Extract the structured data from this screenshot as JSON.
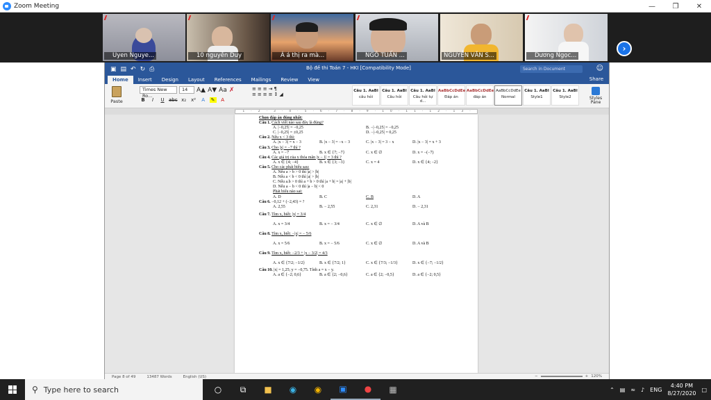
{
  "zoom": {
    "title": "Zoom Meeting",
    "participants": [
      {
        "name": "Uyen Nguye..."
      },
      {
        "name": "10 nguyễn Duy"
      },
      {
        "name": "Á á thị ra mà..."
      },
      {
        "name": "NGÔ TUẤN ..."
      },
      {
        "name": "NGUYỄN VĂN S..."
      },
      {
        "name": "Dương Ngọc..."
      }
    ]
  },
  "word": {
    "doc_title": "Bộ đề thi Toán 7 - HKI [Compatibility Mode]",
    "search_placeholder": "Search in Document",
    "share": "Share",
    "tabs": [
      "Home",
      "Insert",
      "Design",
      "Layout",
      "References",
      "Mailings",
      "Review",
      "View"
    ],
    "paste": "Paste",
    "font_name": "Times New Ro...",
    "font_size": "14",
    "styles": [
      {
        "sample": "Câu 1. AaBl",
        "name": "câu hỏi"
      },
      {
        "sample": "Câu 1. AaBl",
        "name": "Câu hỏi"
      },
      {
        "sample": "Câu 1. AaBl",
        "name": "Câu hỏi tự d..."
      },
      {
        "sample": "AaBbCcDdEe",
        "name": "Đáp án"
      },
      {
        "sample": "AaBbCcDdEe",
        "name": "đáp án"
      },
      {
        "sample": "AaBbCcDdEe",
        "name": "Normal"
      },
      {
        "sample": "Câu 1. AaBl",
        "name": "Style1"
      },
      {
        "sample": "Câu 1. AaBl",
        "name": "Style2"
      }
    ],
    "styles_pane": "Styles Pane",
    "status": {
      "page": "Page 8 of 49",
      "words": "13487 Words",
      "lang": "English (US)",
      "zoom": "120%"
    }
  },
  "document": {
    "heading": "Chọn đáp án đúng nhất:",
    "q1": {
      "label": "Câu 1.",
      "text": "Cách viết nào sau đây là đúng?",
      "a": "A. |−0,25| = −0,25",
      "b": "B. −|−0,25| = −0,25",
      "c": "C. |−0,25| = ±0,25",
      "d": "D. −|−0,25| = 0,25"
    },
    "q2": {
      "label": "Câu 2.",
      "text": "Nếu x < 3 thì:",
      "a": "A. |x − 3| = x − 3",
      "b": "B. |x − 3| = −x − 3",
      "c": "C. |x − 3| = 3 − x",
      "d": "D. |x − 3| = x + 3"
    },
    "q3": {
      "label": "Câu 3.",
      "text": "Cho |x| = −7  thì ?",
      "a": "A. x = −7",
      "b": "B. x ∈ {7; −7}",
      "c": "C. x ∈ ∅",
      "d": "D. x = −(−7)"
    },
    "q4": {
      "label": "Câu 4.",
      "text": "Các giá trị của x thỏa mãn |x − 1| = 3 thì ?",
      "a": "A. x ∈ {4; −4}",
      "b": "B. x ∈ {3; −3}",
      "c": "C. x = 4",
      "d": "D. x ∈ {4; −2}"
    },
    "q5": {
      "label": "Câu 5.",
      "text": "Cho các phát biểu sau:",
      "s1": "A. Nếu a > b > 0 thì |a| > |b|",
      "s2": "B. Nếu a < b < 0 thì |a| > |b|",
      "s3": "C. Nếu a.b > 0 thì a + b > 0 thì |a + b| = |a| + |b|",
      "s4": "D. Nếu a − b < 0 thì |a − b| < 0",
      "ask": "Phát biểu nào sai:",
      "a": "A. D",
      "b": "B. C",
      "c": "C. B",
      "d": "D. A"
    },
    "q6": {
      "label": "Câu 6.",
      "text": "−0,12 + (−2,43) = ?",
      "a": "A. 2,55",
      "b": "B. − 2,55",
      "c": "C. 2,31",
      "d": "D. − 2,31"
    },
    "q7": {
      "label": "Câu 7.",
      "text": "Tìm x, biết: |x| = 3/4",
      "a": "A. x = 3/4",
      "b": "B. x = − 3/4",
      "c": "C. x ∈ ∅",
      "d": "D. A và B"
    },
    "q8": {
      "label": "Câu 8.",
      "text": "Tìm x, biết: −|x| = − 5/6",
      "a": "A. x = 5/6",
      "b": "B. x = − 5/6",
      "c": "C. x ∈ ∅",
      "d": "D. A và B"
    },
    "q9": {
      "label": "Câu 9.",
      "text": "Tìm x, biết: −2/3 + |x − 3/2| = 4/3",
      "a": "A. x ∈ {7/2; −1/2}",
      "b": "B. x ∈ {7/2; 1}",
      "c": "C. x ∈ {7/3; −1/3}",
      "d": "D. x ∈ {−7; −1/2}"
    },
    "q10": {
      "label": "Câu 10.",
      "text": "|x| = 1,25; y = −0,75. Tính a = x − y.",
      "a": "A. a ∈ {−2; 0,6}",
      "b": "B. a ∈ {2; −0,6}",
      "c": "C. a ∈ {2; −0,5}",
      "d": "D. a ∈ {−2; 0,5}"
    }
  },
  "taskbar": {
    "search_placeholder": "Type here to search",
    "lang": "ENG",
    "time": "4:40 PM",
    "date": "8/27/2020"
  }
}
